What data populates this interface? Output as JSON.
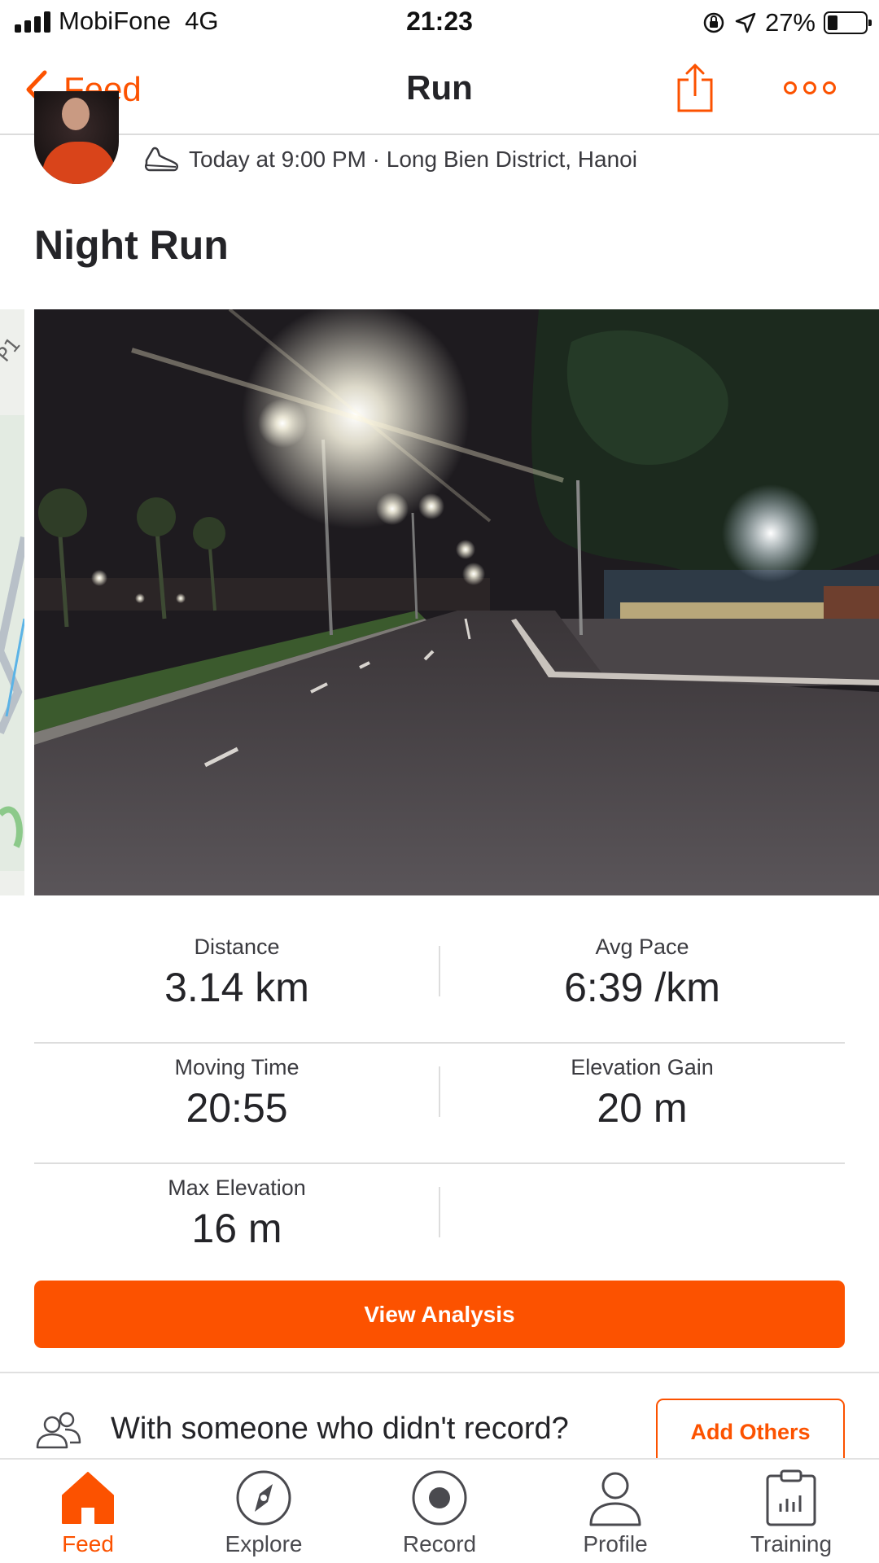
{
  "status_bar": {
    "carrier": "MobiFone",
    "network": "4G",
    "time": "21:23",
    "battery_percent": "27%",
    "battery_level": 0.27
  },
  "nav": {
    "back_label": "Feed",
    "title": "Run",
    "share_icon": "share-icon",
    "more_icon": "more-icon"
  },
  "activity": {
    "meta": "Today at 9:00 PM · Long Bien District, Hanoi",
    "meta_icon": "shoe-icon",
    "title": "Night Run",
    "map_peek_label": "P1"
  },
  "stats": {
    "distance_label": "Distance",
    "distance_value": "3.14 km",
    "avg_pace_label": "Avg Pace",
    "avg_pace_value": "6:39 /km",
    "moving_time_label": "Moving Time",
    "moving_time_value": "20:55",
    "elevation_gain_label": "Elevation Gain",
    "elevation_gain_value": "20 m",
    "max_elevation_label": "Max Elevation",
    "max_elevation_value": "16 m"
  },
  "actions": {
    "view_analysis": "View Analysis",
    "with_others_text": "With someone who didn't record?",
    "add_others": "Add Others"
  },
  "tabs": [
    {
      "label": "Feed",
      "icon": "home-icon",
      "active": true
    },
    {
      "label": "Explore",
      "icon": "compass-icon",
      "active": false
    },
    {
      "label": "Record",
      "icon": "record-icon",
      "active": false
    },
    {
      "label": "Profile",
      "icon": "profile-icon",
      "active": false
    },
    {
      "label": "Training",
      "icon": "training-icon",
      "active": false
    }
  ],
  "colors": {
    "accent": "#fc5200",
    "text": "#242428",
    "divider": "#dddddd"
  }
}
